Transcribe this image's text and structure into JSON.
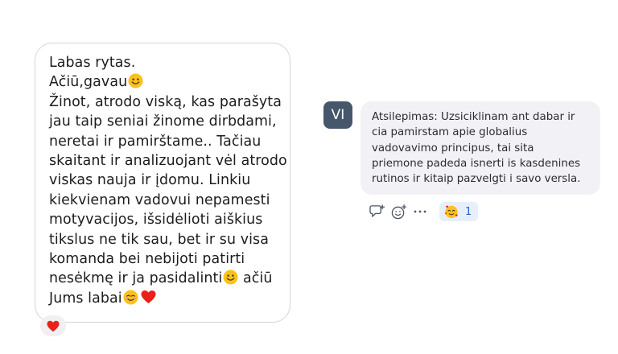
{
  "left_message": {
    "lines": [
      {
        "text": "Labas rytas.",
        "emoji": ""
      },
      {
        "text": "Ačiū,gavau",
        "emoji": "slightly-smiling-face"
      },
      {
        "text": "Žinot, atrodo viską, kas parašyta",
        "emoji": ""
      },
      {
        "text": "jau taip seniai žinome dirbdami,",
        "emoji": ""
      },
      {
        "text": "neretai ir pamirštame.. Tačiau",
        "emoji": ""
      },
      {
        "text": "skaitant ir analizuojant vėl atrodo",
        "emoji": ""
      },
      {
        "text": "viskas nauja ir įdomu. Linkiu",
        "emoji": ""
      },
      {
        "text": "kiekvienam vadovui nepamesti",
        "emoji": ""
      },
      {
        "text": "motyvacijos, išsidėlioti aiškius",
        "emoji": ""
      },
      {
        "text": "tikslus ne tik sau, bet ir su visa",
        "emoji": ""
      },
      {
        "text": "komanda bei nebijoti patirti",
        "emoji": ""
      },
      {
        "text": "nesėkmę ir ja pasidalinti",
        "emoji": "slightly-smiling-face",
        "after": " ačiū"
      },
      {
        "text": "Jums labai",
        "emoji": "smiling-face",
        "emoji2": "red-heart"
      }
    ],
    "reaction": {
      "emoji": "red-heart"
    }
  },
  "right_message": {
    "avatar_initials": "VI",
    "lines": [
      "Atsilepimas: Uzsiciklinam ant dabar ir",
      "cia pamirstam apie globalius",
      "vadovavimo principus, tai sita",
      "priemone padeda isnerti is kasdenines",
      "rutinos ir kitaip pazvelgti i savo versla."
    ],
    "actions": [
      "add-comment-icon",
      "add-reaction-icon",
      "more-options-icon"
    ],
    "reaction": {
      "emoji": "smiling-face-with-hearts",
      "count": "1"
    }
  },
  "colors": {
    "avatar_bg": "#46566b",
    "bubble_right_bg": "#f2f2f6",
    "reaction_right_bg": "#e7effb",
    "reaction_count": "#2862c7"
  }
}
